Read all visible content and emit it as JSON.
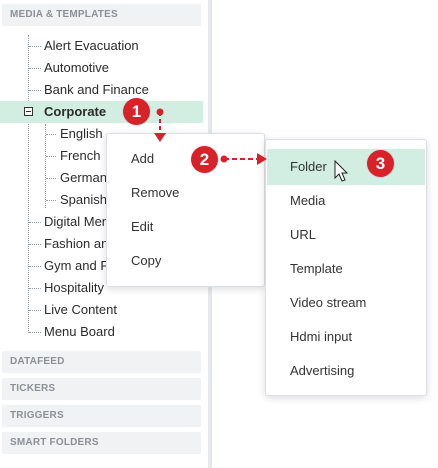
{
  "sidebar": {
    "sections": {
      "media_templates": "MEDIA & TEMPLATES",
      "datafeed": "DATAFEED",
      "tickers": "TICKERS",
      "triggers": "TRIGGERS",
      "smart_folders": "SMART FOLDERS"
    },
    "items": [
      {
        "label": "Alert Evacuation"
      },
      {
        "label": "Automotive"
      },
      {
        "label": "Bank and Finance"
      },
      {
        "label": "Corporate",
        "selected": true
      },
      {
        "label": "English"
      },
      {
        "label": "French"
      },
      {
        "label": "German"
      },
      {
        "label": "Spanish"
      },
      {
        "label": "Digital Menu"
      },
      {
        "label": "Fashion and"
      },
      {
        "label": "Gym and Fi"
      },
      {
        "label": "Hospitality"
      },
      {
        "label": "Live Content"
      },
      {
        "label": "Menu Board"
      }
    ]
  },
  "context_menu": {
    "items": [
      "Add",
      "Remove",
      "Edit",
      "Copy"
    ]
  },
  "add_submenu": {
    "items": [
      "Folder",
      "Media",
      "URL",
      "Template",
      "Video stream",
      "Hdmi input",
      "Advertising"
    ],
    "highlighted": "Folder"
  },
  "annotations": {
    "step1": "1",
    "step2": "2",
    "step3": "3",
    "color": "#d9212a",
    "highlight_color": "#d2eee3"
  }
}
